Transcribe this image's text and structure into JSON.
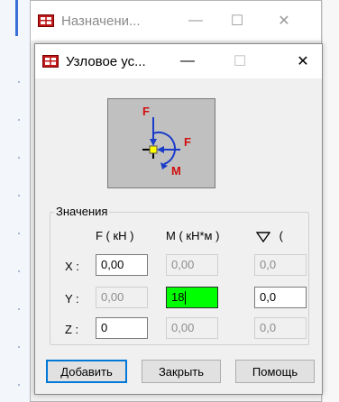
{
  "background_window": {
    "title": "Назначени...",
    "minimize_glyph": "—",
    "maximize_glyph": "☐",
    "close_glyph": "✕"
  },
  "dialog": {
    "title": "Узловое ус...",
    "minimize_glyph": "—",
    "maximize_glyph": "☐",
    "close_glyph": "✕",
    "diagram": {
      "label_F_top": "F",
      "label_F_right": "F",
      "label_M": "M"
    },
    "values_group": {
      "caption": "Значения",
      "col_f": "F ( кН )",
      "col_m": "M ( кН*м )",
      "col_angle_paren": "(",
      "rows": [
        {
          "label": "X :",
          "f": "0,00",
          "m": "0,00",
          "angle": "0,0"
        },
        {
          "label": "Y :",
          "f": "0,00",
          "m": "18",
          "angle": "0,0"
        },
        {
          "label": "Z :",
          "f": "0",
          "m": "0,00",
          "angle": "0,0"
        }
      ]
    },
    "buttons": {
      "add": "Добавить",
      "close": "Закрыть",
      "help": "Помощь"
    }
  },
  "colors": {
    "active_field": "#00ff00",
    "force_label": "#d01010",
    "moment_arrow": "#1a3cc8",
    "node": "#ffff00"
  }
}
